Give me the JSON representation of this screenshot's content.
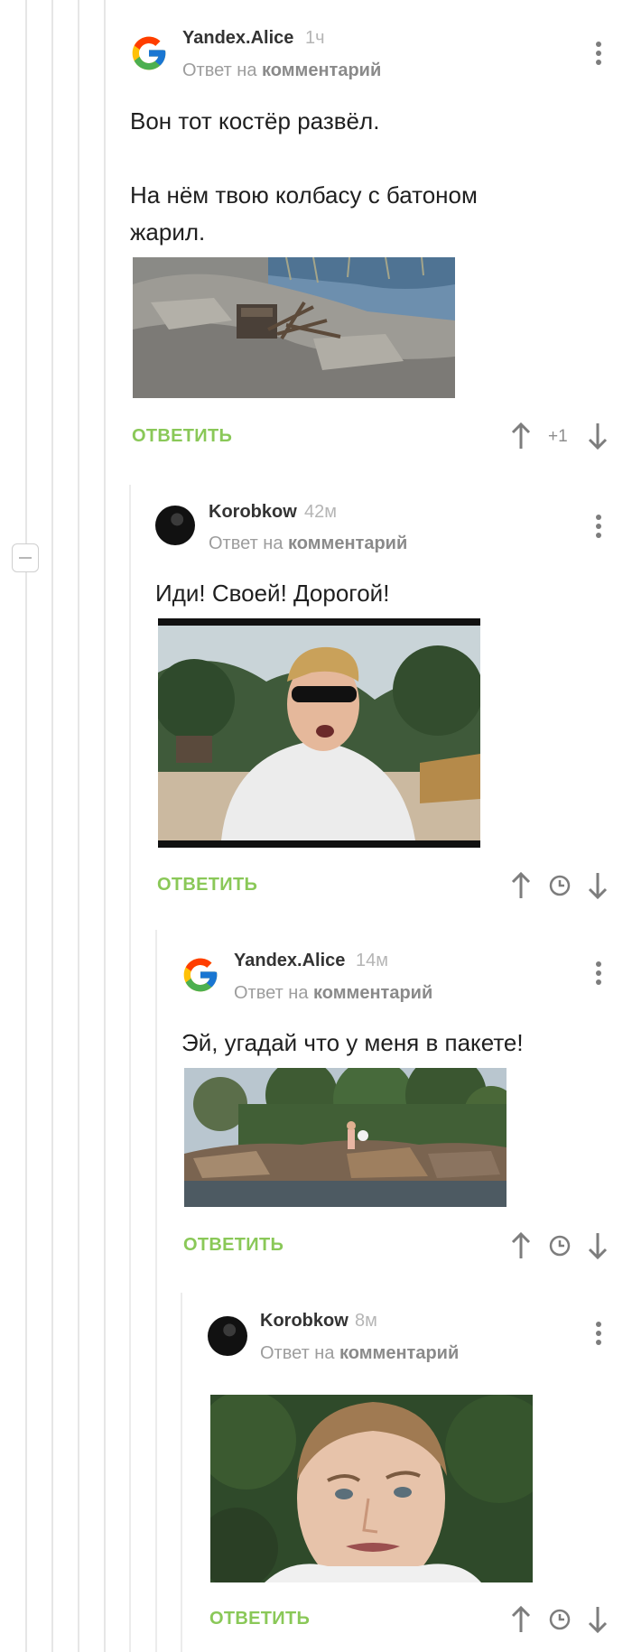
{
  "collapse_label": "−",
  "comments": [
    {
      "author": "Yandex.Alice",
      "time": "1ч",
      "reply_prefix": "Ответ на",
      "reply_target": "комментарий",
      "text_lines": [
        "Вон тот костёр развёл.",
        "",
        "На нём твою колбасу с батоном",
        "жарил."
      ],
      "media": "photo-campfire-on-rocks",
      "reply_label": "ОТВЕТИТЬ",
      "rating": "+1"
    },
    {
      "author": "Korobkow",
      "time": "42м",
      "reply_prefix": "Ответ на",
      "reply_target": "комментарий",
      "text_lines": [
        "Иди! Своей! Дорогой!"
      ],
      "media": "gif-man-in-sunglasses-shouting",
      "reply_label": "ОТВЕТИТЬ",
      "rating_icon": "clock-icon"
    },
    {
      "author": "Yandex.Alice",
      "time": "14м",
      "reply_prefix": "Ответ на",
      "reply_target": "комментарий",
      "text_lines": [
        "Эй, угадай что у меня в пакете!"
      ],
      "media": "photo-man-on-rocky-island",
      "reply_label": "ОТВЕТИТЬ",
      "rating_icon": "clock-icon"
    },
    {
      "author": "Korobkow",
      "time": "8м",
      "reply_prefix": "Ответ на",
      "reply_target": "комментарий",
      "text_lines": [],
      "media": "gif-man-puzzled-face",
      "reply_label": "ОТВЕТИТЬ",
      "rating_icon": "clock-icon"
    }
  ],
  "colors": {
    "accent_green": "#8ac858",
    "icon_gray": "#7d7d7d",
    "rail_gray": "#e6e6e6"
  }
}
